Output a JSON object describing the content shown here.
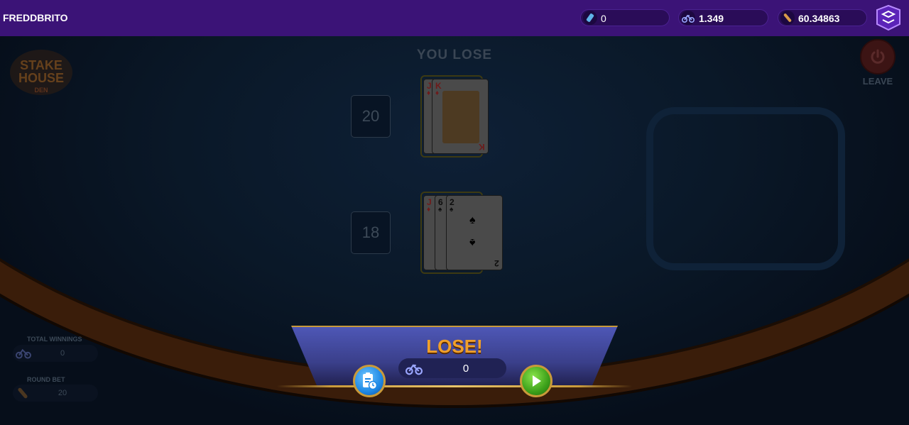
{
  "header": {
    "username": "FREDDBRITO",
    "balances": [
      {
        "icon": "gem-bottle-icon",
        "value": "0"
      },
      {
        "icon": "bike-token-icon",
        "value": "1.349"
      },
      {
        "icon": "bottle-token-icon",
        "value": "60.34863"
      }
    ],
    "app_logo_icon": "app-logo-icon"
  },
  "game": {
    "logo_text": [
      "STAKE",
      "HOUSE",
      "DEN"
    ],
    "result_title": "YOU LOSE",
    "leave_label": "LEAVE",
    "dealer": {
      "score": "20",
      "cards": [
        {
          "rank": "J",
          "suit": "♦"
        },
        {
          "rank": "K",
          "suit": "♦"
        }
      ]
    },
    "player": {
      "score": "18",
      "cards": [
        {
          "rank": "J",
          "suit": "♦"
        },
        {
          "rank": "6",
          "suit": "♠"
        },
        {
          "rank": "2",
          "suit": "♠"
        }
      ]
    }
  },
  "side_info": {
    "total_winnings_label": "TOTAL WINNINGS",
    "total_winnings_value": "0",
    "round_bet_label": "ROUND BET",
    "round_bet_value": "20"
  },
  "result_panel": {
    "title": "LOSE!",
    "winnings_value": "0"
  },
  "colors": {
    "topbar": "#3b1377",
    "lose_text": "#f0a02a",
    "panel": "#4e57b6",
    "gold": "#c99a3a"
  }
}
